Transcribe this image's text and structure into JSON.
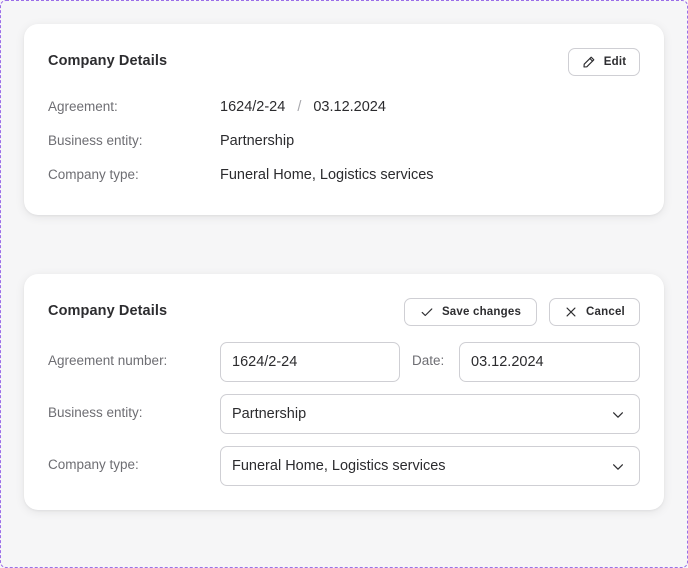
{
  "view_card": {
    "title": "Company Details",
    "edit_label": "Edit",
    "agreement_label": "Agreement:",
    "agreement_number": "1624/2-24",
    "agreement_separator": "/",
    "agreement_date": "03.12.2024",
    "business_entity_label": "Business entity:",
    "business_entity": "Partnership",
    "company_type_label": "Company type:",
    "company_type": "Funeral Home, Logistics services"
  },
  "edit_card": {
    "title": "Company Details",
    "save_label": "Save changes",
    "cancel_label": "Cancel",
    "agreement_number_label": "Agreement number:",
    "agreement_number_value": "1624/2-24",
    "date_label": "Date:",
    "date_value": "03.12.2024",
    "business_entity_label": "Business entity:",
    "business_entity_value": "Partnership",
    "company_type_label": "Company type:",
    "company_type_value": "Funeral Home, Logistics services"
  },
  "icons": [
    "pencil-icon",
    "check-icon",
    "close-icon",
    "chevron-down-icon"
  ],
  "colors": {
    "dashed_border": "#9b6ee8",
    "card_bg": "#ffffff",
    "label": "#6e6e73"
  }
}
